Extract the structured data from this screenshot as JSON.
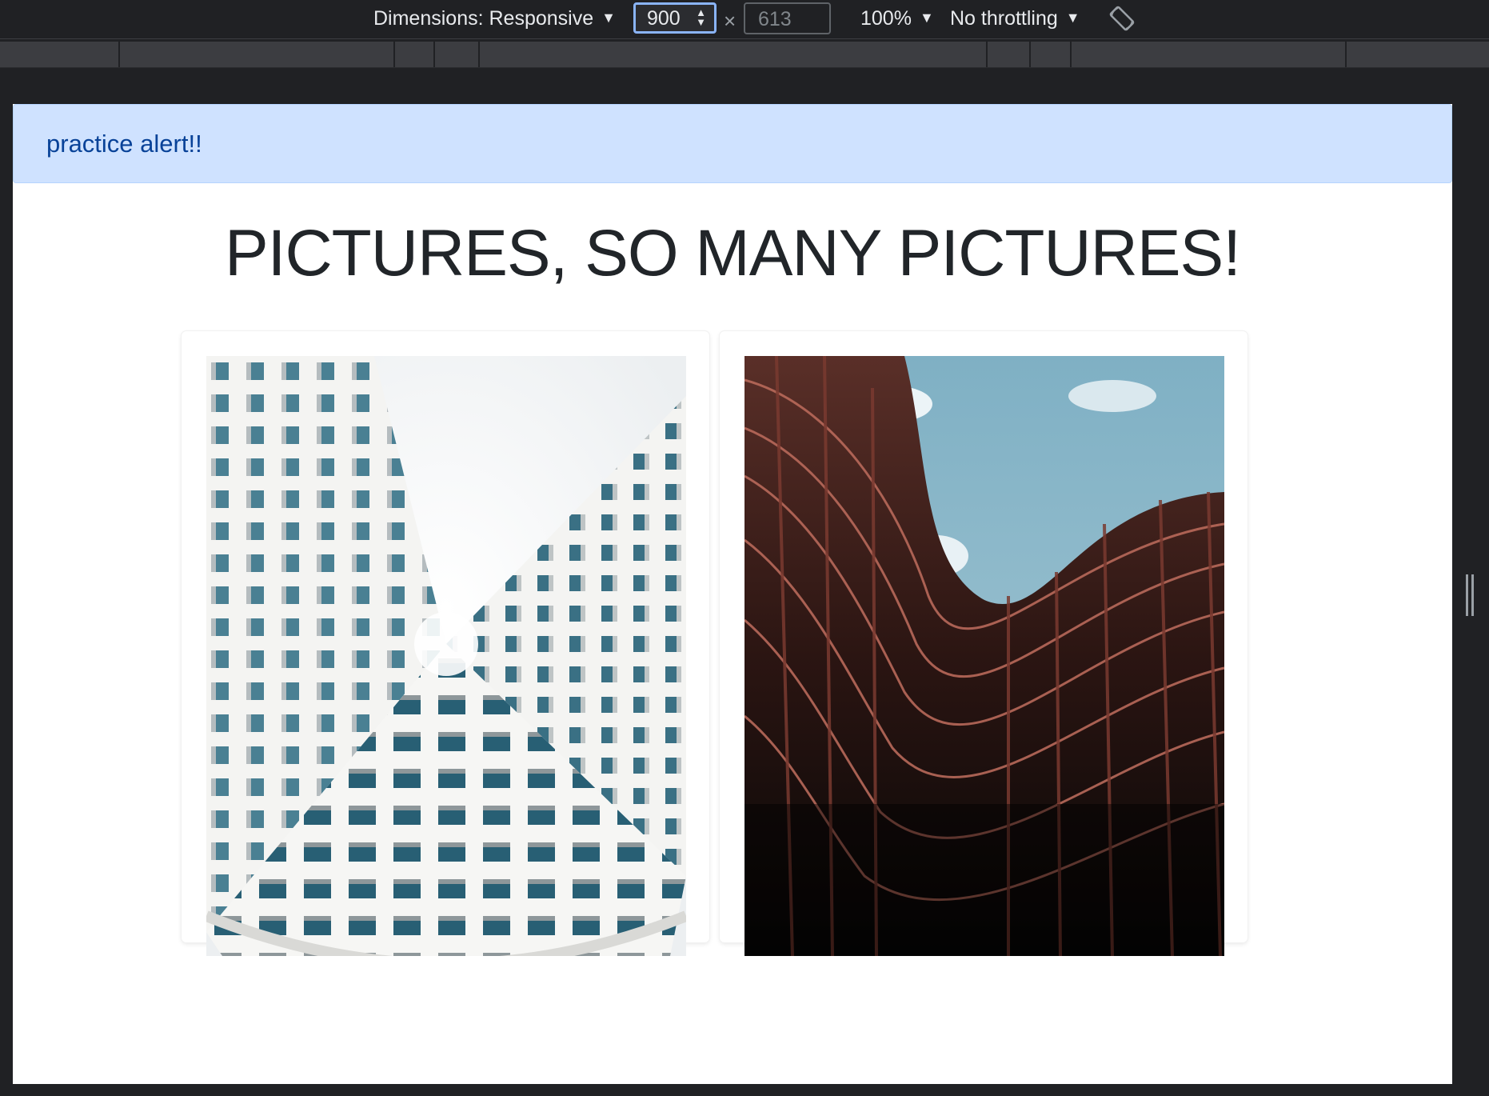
{
  "devtools": {
    "dimensions_label": "Dimensions: Responsive",
    "width_value": "900",
    "times_symbol": "×",
    "height_placeholder": "613",
    "zoom_label": "100%",
    "throttling_label": "No throttling",
    "caret": "▼",
    "spin": "▲▼",
    "rotate_icon": "rotate-icon"
  },
  "page": {
    "alert_text": "practice alert!!",
    "heading": "PICTURES, SO MANY PICTURES!",
    "cards": [
      {
        "image": "white-building-looking-up"
      },
      {
        "image": "red-curved-building-looking-up"
      }
    ]
  },
  "colors": {
    "alert_bg": "#cfe2ff",
    "alert_text": "#084298",
    "heading": "#212529",
    "focus_ring": "#8ab4f8"
  }
}
